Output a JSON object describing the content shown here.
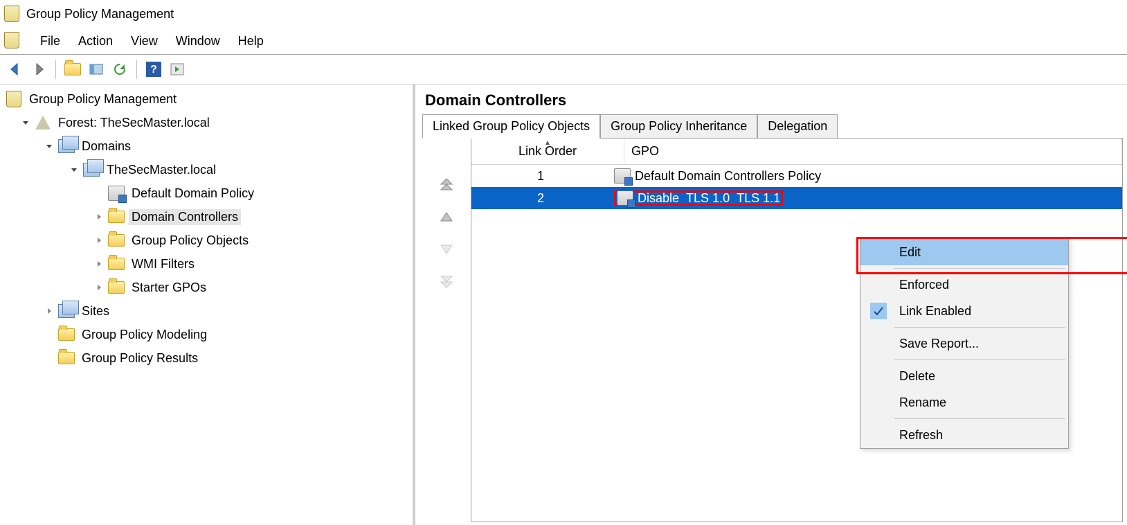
{
  "window": {
    "title": "Group Policy Management"
  },
  "menu": {
    "file": "File",
    "action": "Action",
    "view": "View",
    "window": "Window",
    "help": "Help"
  },
  "tree": {
    "root": "Group Policy Management",
    "forest": "Forest: TheSecMaster.local",
    "domains": "Domains",
    "domain": "TheSecMaster.local",
    "default_domain_policy": "Default Domain Policy",
    "domain_controllers": "Domain Controllers",
    "gpo": "Group Policy Objects",
    "wmi": "WMI Filters",
    "starter": "Starter GPOs",
    "sites": "Sites",
    "modeling": "Group Policy Modeling",
    "results": "Group Policy Results"
  },
  "right": {
    "heading": "Domain Controllers",
    "tabs": {
      "linked": "Linked Group Policy Objects",
      "inheritance": "Group Policy Inheritance",
      "delegation": "Delegation"
    },
    "columns": {
      "order": "Link Order",
      "gpo": "GPO"
    },
    "rows": [
      {
        "order": "1",
        "gpo": "Default Domain Controllers Policy"
      },
      {
        "order": "2",
        "gpo": "Disable_TLS 1.0_TLS 1.1"
      }
    ]
  },
  "context_menu": {
    "edit": "Edit",
    "enforced": "Enforced",
    "link_enabled": "Link Enabled",
    "save_report": "Save Report...",
    "delete": "Delete",
    "rename": "Rename",
    "refresh": "Refresh"
  }
}
